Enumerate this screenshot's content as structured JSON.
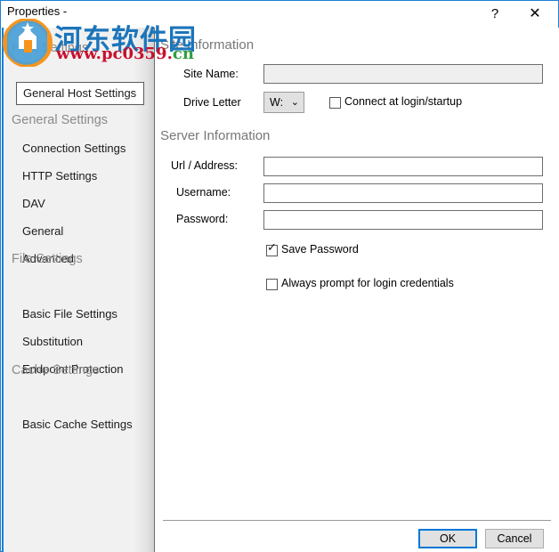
{
  "window": {
    "title": "Properties -",
    "help_glyph": "?",
    "close_glyph": "✕"
  },
  "sidebar": {
    "groups": [
      {
        "header": "Host Settings",
        "items": [
          {
            "label": "General Host Settings",
            "selected": true
          }
        ]
      },
      {
        "header": "General Settings",
        "items": [
          {
            "label": "Connection Settings",
            "selected": false
          },
          {
            "label": "HTTP Settings",
            "selected": false
          },
          {
            "label": "DAV",
            "selected": false
          },
          {
            "label": "General",
            "selected": false
          },
          {
            "label": "Advanced",
            "selected": false
          }
        ]
      },
      {
        "header": "File Settings",
        "items": [
          {
            "label": "Basic File Settings",
            "selected": false
          },
          {
            "label": "Substitution",
            "selected": false
          },
          {
            "label": "Endpoint Protection",
            "selected": false
          }
        ]
      },
      {
        "header": "Cache Settings",
        "items": [
          {
            "label": "Basic Cache Settings",
            "selected": false
          }
        ]
      }
    ]
  },
  "content": {
    "site_information": {
      "title": "Site Information",
      "site_name_label": "Site Name:",
      "site_name_value": "",
      "drive_letter_label": "Drive Letter",
      "drive_letter_value": "W:",
      "drive_letter_chevron": "⌄",
      "connect_at_login_label": "Connect at login/startup",
      "connect_at_login_checked": false
    },
    "server_information": {
      "title": "Server Information",
      "url_label": "Url / Address:",
      "url_value": "",
      "username_label": "Username:",
      "username_value": "",
      "password_label": "Password:",
      "password_value": "",
      "save_password_label": "Save Password",
      "save_password_checked": true,
      "always_prompt_label": "Always prompt for login credentials",
      "always_prompt_checked": false
    }
  },
  "footer": {
    "ok_label": "OK",
    "cancel_label": "Cancel"
  },
  "watermark": {
    "site_name_cn": "河东软件园",
    "url_main": "www.pc0359.",
    "url_tld": "cn"
  },
  "colors": {
    "accent_blue": "#0078d7",
    "window_border": "#1a7fd4",
    "sidebar_bg": "#f1f1f1",
    "group_header_text": "#8a8a8a",
    "section_title_text": "#777777",
    "watermark_blue": "#1b75bb",
    "watermark_red": "#c8102e",
    "watermark_green": "#2e9e3e"
  }
}
